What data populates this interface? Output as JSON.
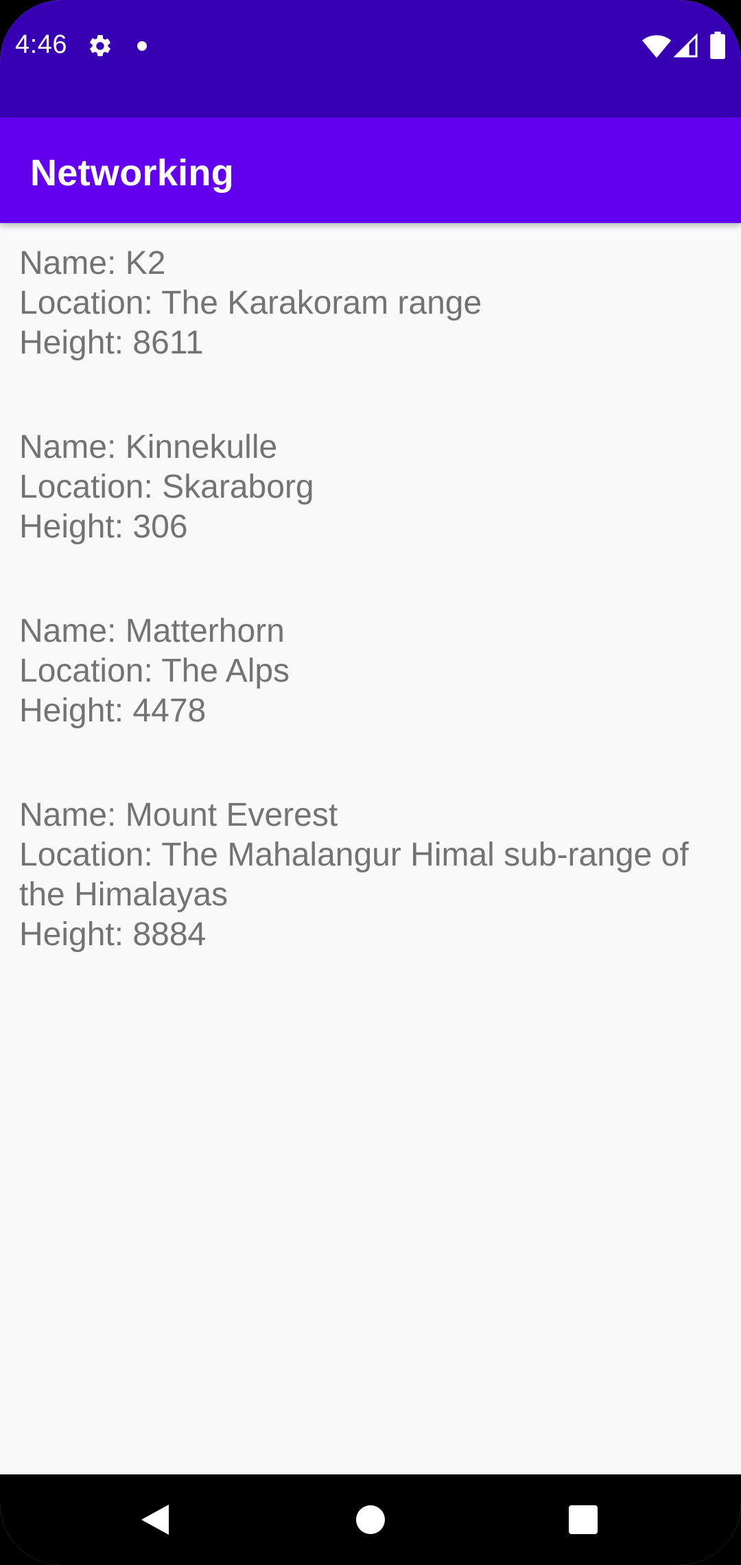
{
  "status_bar": {
    "time": "4:46",
    "icons": [
      "gear-icon",
      "notification-dot-icon",
      "wifi-icon",
      "signal-icon",
      "battery-icon"
    ],
    "color": "#3700b3"
  },
  "app_bar": {
    "title": "Networking",
    "color": "#6200ee"
  },
  "mountains": [
    {
      "name": "Name: K2",
      "location": "Location: The Karakoram range",
      "height": "Height: 8611"
    },
    {
      "name": "Name: Kinnekulle",
      "location": "Location: Skaraborg",
      "height": "Height: 306"
    },
    {
      "name": "Name: Matterhorn",
      "location": "Location: The Alps",
      "height": "Height: 4478"
    },
    {
      "name": "Name: Mount Everest",
      "location": "Location: The Mahalangur Himal sub-range of the Himalayas",
      "height": "Height: 8884"
    }
  ],
  "nav_bar": {
    "icons": [
      "back-icon",
      "home-icon",
      "recents-icon"
    ]
  }
}
